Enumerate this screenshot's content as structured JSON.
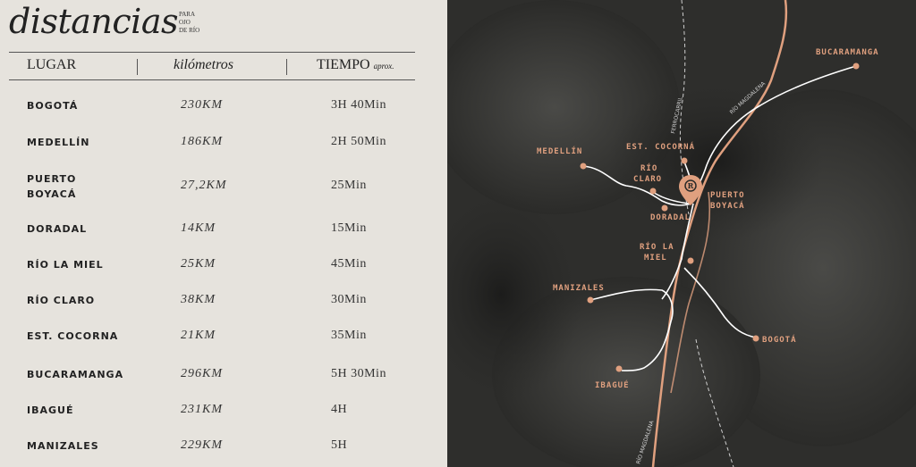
{
  "header": {
    "title": "distancias",
    "subtitle_lines": [
      "PARA",
      "OJO",
      "DE RÍO"
    ]
  },
  "table": {
    "columns": {
      "place": "LUGAR",
      "km": "kilómetros",
      "time": "TIEMPO",
      "time_note": "aprox."
    },
    "rows": [
      {
        "place": "BOGOTÁ",
        "km": "230KM",
        "time": "3H 40Min"
      },
      {
        "place": "MEDELLÍN",
        "km": "186KM",
        "time": "2H 50Min"
      },
      {
        "place": "PUERTO\nBOYACÁ",
        "km": "27,2KM",
        "time": "25Min"
      },
      {
        "place": "DORADAL",
        "km": "14KM",
        "time": "15Min"
      },
      {
        "place": "RÍO LA MIEL",
        "km": "25KM",
        "time": "45Min"
      },
      {
        "place": "RÍO CLARO",
        "km": "38KM",
        "time": "30Min"
      },
      {
        "place": "EST. COCORNA",
        "km": "21KM",
        "time": "35Min"
      },
      {
        "place": "BUCARAMANGA",
        "km": "296KM",
        "time": "5H 30Min"
      },
      {
        "place": "IBAGUÉ",
        "km": "231KM",
        "time": "4H"
      },
      {
        "place": "MANIZALES",
        "km": "229KM",
        "time": "5H"
      }
    ]
  },
  "map": {
    "labels": {
      "bucaramanga": "BUCARAMANGA",
      "medellin": "MEDELLÍN",
      "cocorna": "EST. COCORNÁ",
      "rio_claro_1": "RÍO",
      "rio_claro_2": "CLARO",
      "puerto_1": "PUERTO",
      "puerto_2": "BOYACÁ",
      "doradal": "DORADAL",
      "rio_la_miel_1": "RÍO LA",
      "rio_la_miel_2": "MIEL",
      "manizales": "MANIZALES",
      "bogota": "BOGOTÁ",
      "ibague": "IBAGUÉ",
      "rio_magdalena_1": "RÍO MAGDALENA",
      "rio_magdalena_2": "RÍO MAGDALENA",
      "ferrocarril": "FERROCARRIL"
    },
    "colors": {
      "accent": "#e0a07f",
      "route": "#ffffff",
      "background": "#2b2b29"
    }
  }
}
